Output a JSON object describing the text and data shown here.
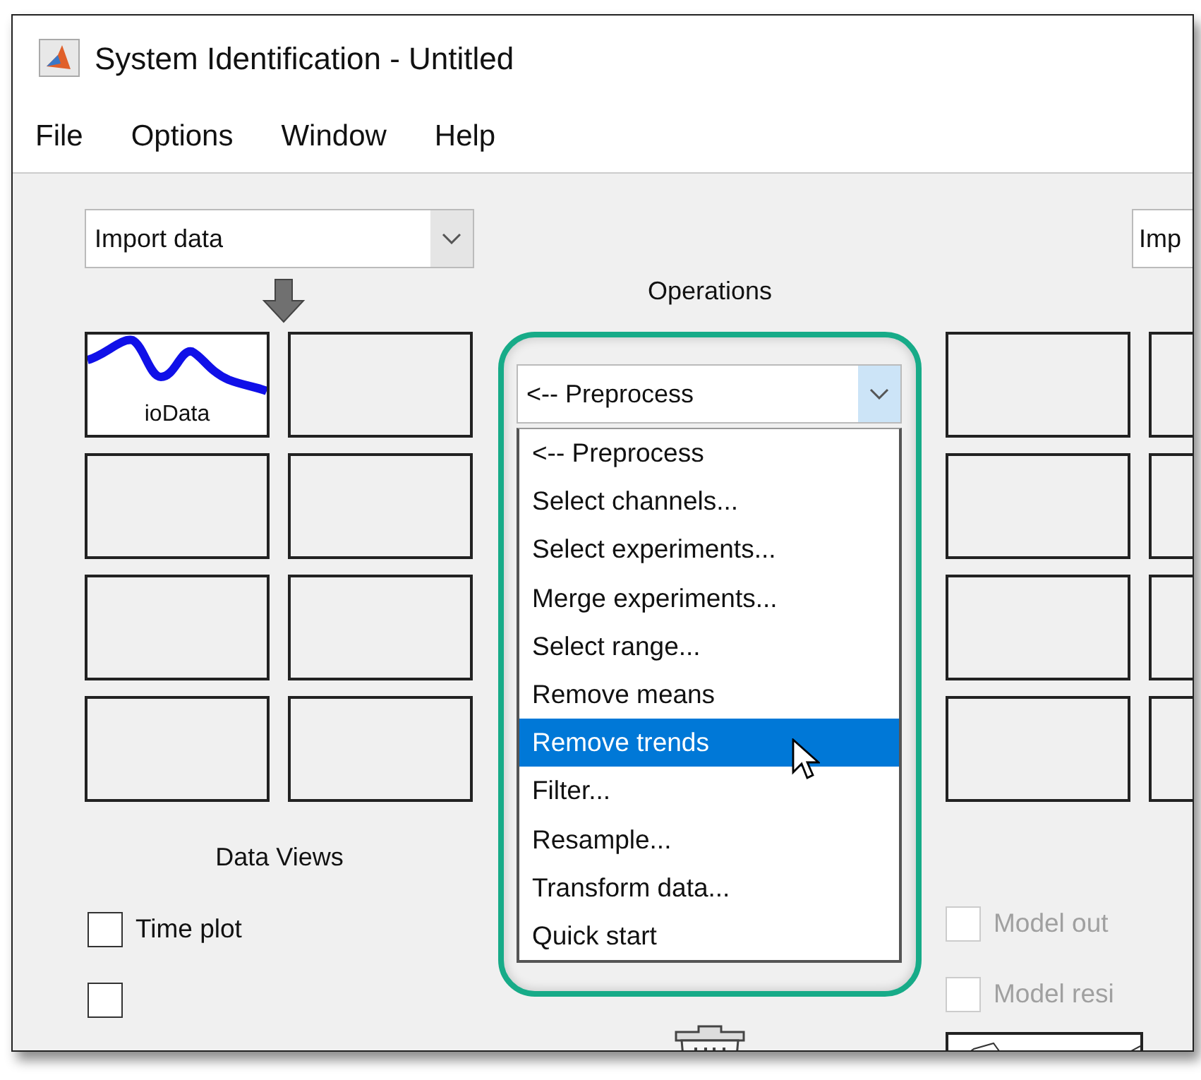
{
  "window": {
    "title": "System Identification - Untitled"
  },
  "menu": [
    "File",
    "Options",
    "Window",
    "Help"
  ],
  "data_panel": {
    "import_dropdown": {
      "value": "Import data"
    },
    "tiles": [
      {
        "label": "ioData",
        "has_data": true
      },
      {
        "has_data": false
      },
      {
        "has_data": false
      },
      {
        "has_data": false
      },
      {
        "has_data": false
      },
      {
        "has_data": false
      },
      {
        "has_data": false
      },
      {
        "has_data": false
      }
    ],
    "heading": "Data Views",
    "checkboxes": [
      {
        "label": "Time plot",
        "checked": false
      },
      {
        "checked": false
      }
    ]
  },
  "operations": {
    "heading": "Operations",
    "dropdown": {
      "value": "<-- Preprocess",
      "expanded": true
    },
    "options": [
      {
        "label": "<-- Preprocess",
        "selected": false
      },
      {
        "label": "Select channels...",
        "selected": false
      },
      {
        "label": "Select experiments...",
        "selected": false
      },
      {
        "label": "Merge experiments...",
        "selected": false
      },
      {
        "label": "Select range...",
        "selected": false
      },
      {
        "label": "Remove means",
        "selected": false
      },
      {
        "label": "Remove trends",
        "selected": true
      },
      {
        "label": "Filter...",
        "selected": false
      },
      {
        "label": "Resample...",
        "selected": false
      },
      {
        "label": "Transform data...",
        "selected": false
      },
      {
        "label": "Quick start",
        "selected": false
      }
    ]
  },
  "model_panel": {
    "import_dropdown": {
      "value": "Imp"
    },
    "tiles": [
      {
        "has_data": false
      },
      {
        "has_data": false
      },
      {
        "has_data": false
      },
      {
        "has_data": false
      },
      {
        "has_data": false
      },
      {
        "has_data": false
      },
      {
        "has_data": false
      },
      {
        "has_data": false
      }
    ],
    "checkboxes": [
      {
        "label": "Model out",
        "checked": false,
        "disabled": true
      },
      {
        "label": "Model resi",
        "checked": false,
        "disabled": true
      }
    ]
  }
}
